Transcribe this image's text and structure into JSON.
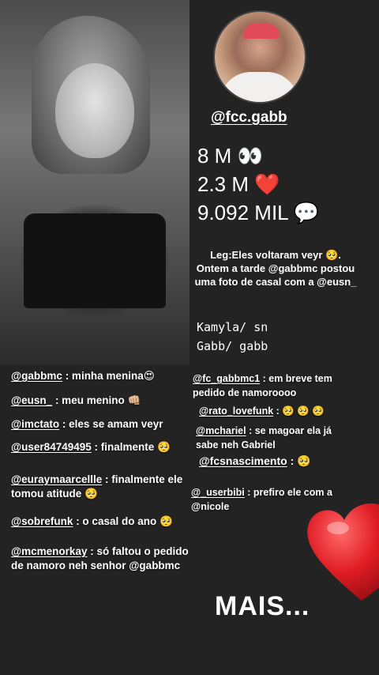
{
  "profile": {
    "handle": "@fcc.gabb",
    "stats": [
      "8 M 👀",
      "2.3 M ❤️",
      "9.092 MIL 💬"
    ]
  },
  "caption": {
    "text": "Leg:Eles voltaram veyr 🥺.\nOntem a tarde @gabbmc postou uma foto de casal com a @eusn_"
  },
  "ship": {
    "line1": "Kamyla/ sn",
    "line2": "Gabb/ gabb"
  },
  "comments_left": [
    {
      "user": "@gabbmc",
      "text": " : minha menina😍"
    },
    {
      "user": "@eusn_",
      "text": " : meu menino 👊🏼"
    },
    {
      "user": "@imctato",
      "text": " : eles se amam veyr"
    },
    {
      "user": "@user84749495",
      "text": " : finalmente 🥺"
    },
    {
      "user": "@euraymaarcellle",
      "text": " : finalmente ele tomou atitude 🥺"
    },
    {
      "user": "@sobrefunk",
      "text": " : o casal do ano 🥺"
    },
    {
      "user": "@mcmenorkay",
      "text": " : só faltou o pedido de namoro neh senhor @gabbmc"
    }
  ],
  "comments_right": [
    {
      "user": "@fc_gabbmc1",
      "text": " : em breve tem pedido de namoroooo"
    },
    {
      "user": "@rato_lovefunk",
      "text": " : 🥺 🥺 🥺"
    },
    {
      "user": "@mchariel",
      "text": " : se magoar ela já sabe neh Gabriel"
    },
    {
      "user": "@fcsnascimento",
      "text": " : 🥺"
    },
    {
      "user": "@_userbibi",
      "text": " : prefiro ele com a @nicole"
    }
  ],
  "footer": {
    "more_label": "MAIS..."
  },
  "colors": {
    "background": "#232323",
    "heart": "#e01c24"
  },
  "icons": [
    "eyes-emoji",
    "heart-emoji",
    "speech-bubble-emoji",
    "big-red-heart-sticker"
  ]
}
